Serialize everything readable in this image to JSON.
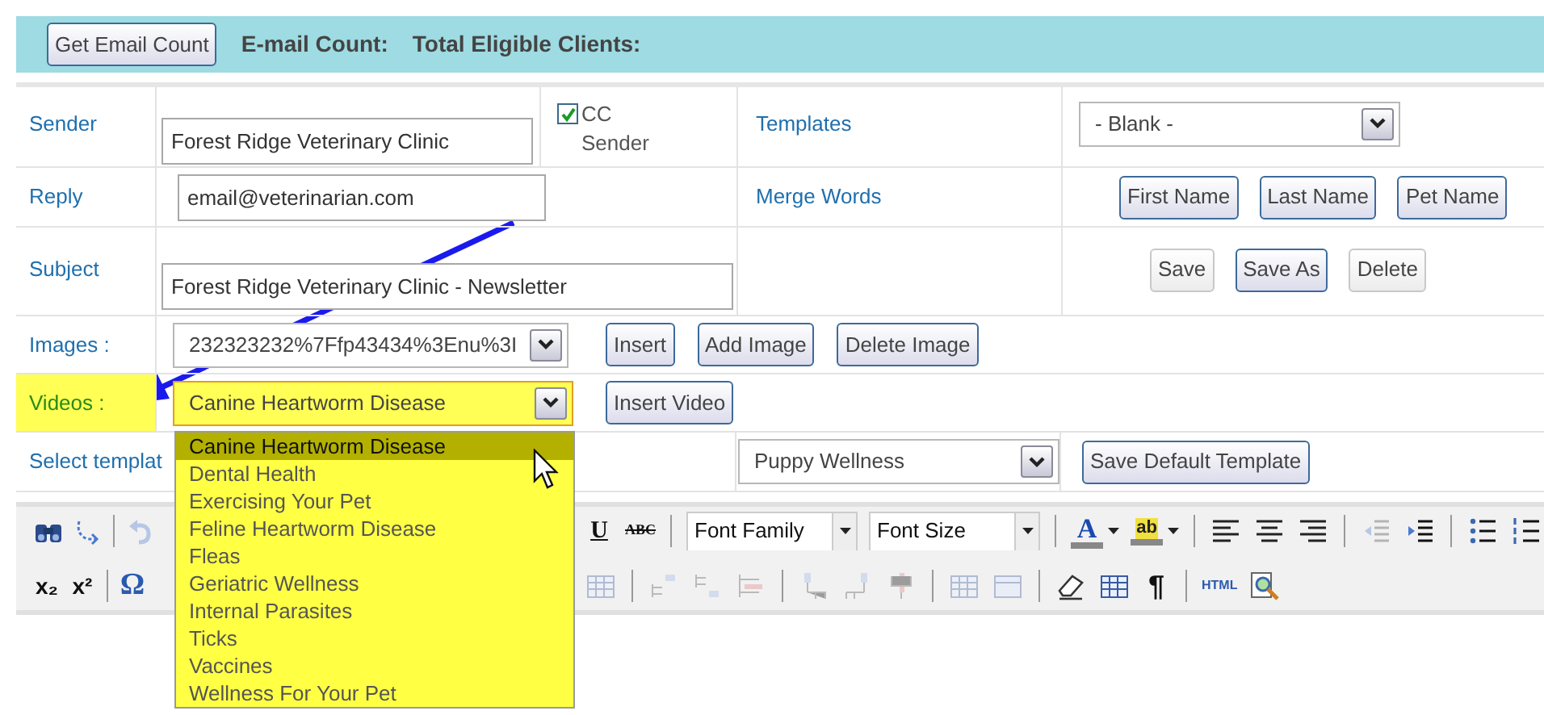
{
  "top_bar": {
    "button": "Get Email Count",
    "labels": [
      "E-mail Count:",
      "Total Eligible Clients:"
    ]
  },
  "form": {
    "sender": {
      "label": "Sender",
      "value": "Forest Ridge Veterinary Clinic"
    },
    "cc_sender": {
      "label": "CC Sender",
      "checked": true
    },
    "templates": {
      "label": "Templates",
      "value": "- Blank -"
    },
    "reply": {
      "label": "Reply",
      "value": "email@veterinarian.com"
    },
    "merge_words": {
      "label": "Merge Words",
      "buttons": [
        "First Name",
        "Last Name",
        "Pet Name"
      ]
    },
    "subject": {
      "label": "Subject",
      "value": "Forest Ridge Veterinary Clinic - Newsletter"
    },
    "template_buttons": [
      {
        "label": "Save",
        "disabled": true
      },
      {
        "label": "Save As",
        "disabled": false
      },
      {
        "label": "Delete",
        "disabled": true
      }
    ],
    "images": {
      "label": "Images :",
      "value": "232323232%7Ffp43434%3Enu%3I",
      "buttons": [
        "Insert",
        "Add Image",
        "Delete Image"
      ]
    },
    "videos": {
      "label": "Videos :",
      "highlighted": true,
      "value": "Canine Heartworm Disease",
      "button": "Insert Video",
      "expanded": true,
      "options": [
        {
          "label": "Canine Heartworm Disease",
          "selected": true
        },
        {
          "label": "Dental Health",
          "selected": false
        },
        {
          "label": "Exercising Your Pet",
          "selected": false
        },
        {
          "label": "Feline Heartworm Disease",
          "selected": false
        },
        {
          "label": "Fleas",
          "selected": false
        },
        {
          "label": "Geriatric Wellness",
          "selected": false
        },
        {
          "label": "Internal Parasites",
          "selected": false
        },
        {
          "label": "Ticks",
          "selected": false
        },
        {
          "label": "Vaccines",
          "selected": false
        },
        {
          "label": "Wellness For Your Pet",
          "selected": false
        }
      ]
    },
    "select_template": {
      "label": "Select templat",
      "value": "Puppy Wellness",
      "button": "Save Default Template"
    }
  },
  "toolbar": {
    "rows": [
      {
        "left": [
          {
            "kind": "find"
          },
          {
            "kind": "replace"
          },
          {
            "kind": "sep"
          },
          {
            "kind": "undo",
            "disabled": true
          }
        ],
        "right": [
          {
            "kind": "underline",
            "text": "U"
          },
          {
            "kind": "strike",
            "text": "ABC"
          },
          {
            "kind": "sep"
          },
          {
            "kind": "select",
            "text": "Font Family"
          },
          {
            "kind": "select",
            "text": "Font Size"
          },
          {
            "kind": "sep"
          },
          {
            "kind": "forecolor",
            "text": "A"
          },
          {
            "kind": "highlight",
            "text": "ab"
          },
          {
            "kind": "sep"
          },
          {
            "kind": "alignleft"
          },
          {
            "kind": "aligncenter"
          },
          {
            "kind": "alignright"
          },
          {
            "kind": "sep"
          },
          {
            "kind": "outdent",
            "disabled": true
          },
          {
            "kind": "indent"
          },
          {
            "kind": "sep"
          },
          {
            "kind": "bullets"
          },
          {
            "kind": "numbers"
          }
        ]
      },
      {
        "left": [
          {
            "kind": "subscript",
            "text": "x₂"
          },
          {
            "kind": "superscript",
            "text": "x²"
          },
          {
            "kind": "sep"
          },
          {
            "kind": "symbol",
            "text": "Ω"
          }
        ],
        "right": [
          {
            "kind": "grid",
            "disabled": true
          },
          {
            "kind": "sep"
          },
          {
            "kind": "rowbefore",
            "disabled": true
          },
          {
            "kind": "rowafter",
            "disabled": true
          },
          {
            "kind": "rowdelete",
            "disabled": true
          },
          {
            "kind": "sep"
          },
          {
            "kind": "colbefore",
            "disabled": true
          },
          {
            "kind": "colafter",
            "disabled": true
          },
          {
            "kind": "coldelete",
            "disabled": true
          },
          {
            "kind": "sep"
          },
          {
            "kind": "grid",
            "disabled": true
          },
          {
            "kind": "split",
            "disabled": true
          },
          {
            "kind": "sep"
          },
          {
            "kind": "eraser"
          },
          {
            "kind": "grid"
          },
          {
            "kind": "para",
            "text": "¶"
          },
          {
            "kind": "sep"
          },
          {
            "kind": "html",
            "text": "HTML"
          },
          {
            "kind": "preview"
          }
        ]
      }
    ]
  }
}
